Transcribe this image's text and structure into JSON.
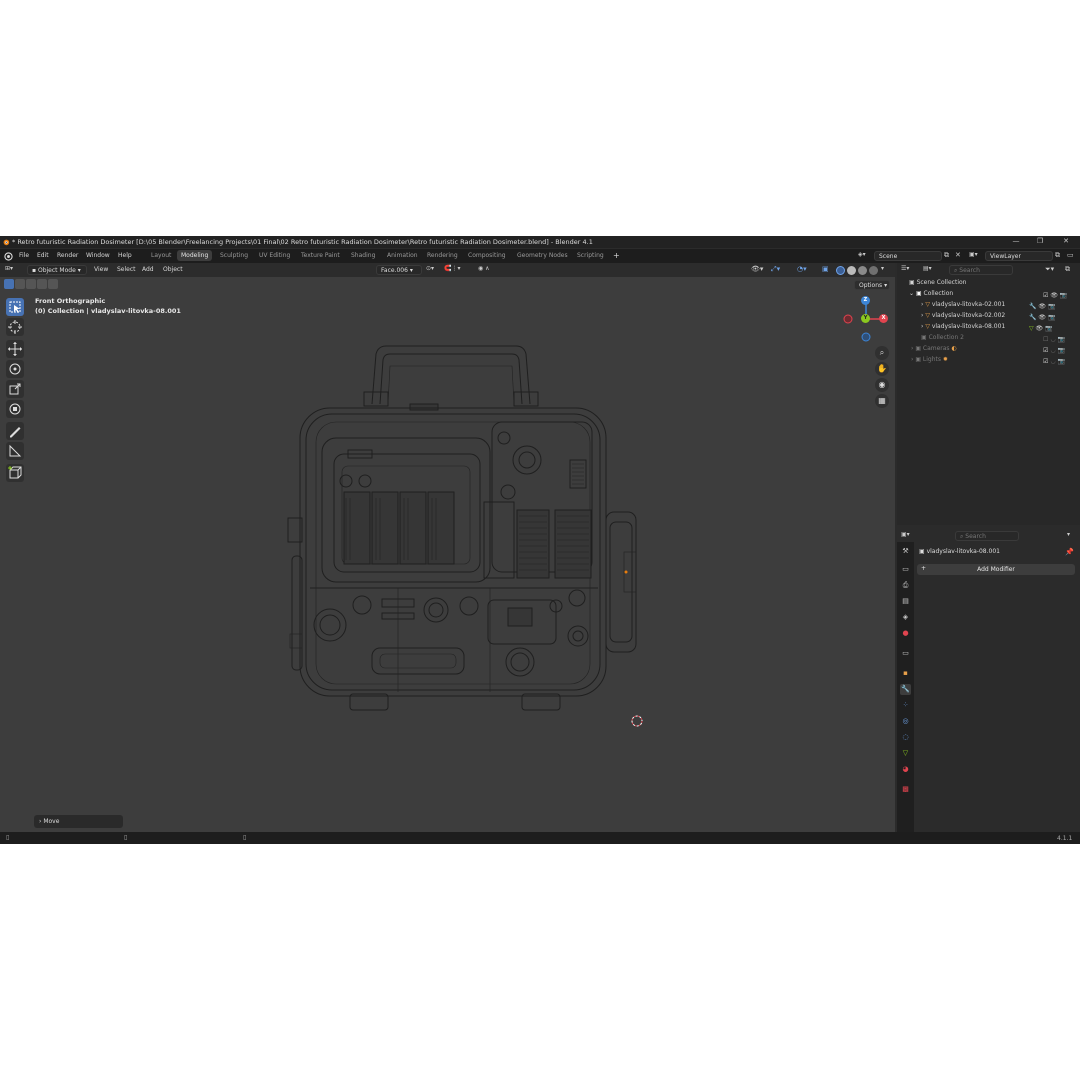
{
  "window": {
    "title": "* Retro futuristic Radiation Dosimeter [D:\\05 Blender\\Freelancing Projects\\01 Final\\02 Retro futuristic Radiation Dosimeter\\Retro futuristic Radiation Dosimeter.blend] - Blender 4.1",
    "controls": [
      "—",
      "❐",
      "✕"
    ]
  },
  "menu": [
    "File",
    "Edit",
    "Render",
    "Window",
    "Help"
  ],
  "workspaces": [
    "Layout",
    "Modeling",
    "Sculpting",
    "UV Editing",
    "Texture Paint",
    "Shading",
    "Animation",
    "Rendering",
    "Compositing",
    "Geometry Nodes",
    "Scripting"
  ],
  "add_workspace": "+",
  "scene": {
    "name": "Scene",
    "view_layer": "ViewLayer"
  },
  "header3d": {
    "mode": "Object Mode",
    "menus": [
      "View",
      "Select",
      "Add",
      "Object"
    ],
    "active_face": "Face.006",
    "options": "Options"
  },
  "viewport": {
    "view_name": "Front Orthographic",
    "collection_info": "(0) Collection | vladyslav-litovka-08.001",
    "gizmo": {
      "z": "Z",
      "y": "Y",
      "x": "X"
    },
    "last_operator": "Move"
  },
  "outliner": {
    "search_placeholder": "Search",
    "scene_collection": "Scene Collection",
    "collection": "Collection",
    "objects": [
      "vladyslav-litovka-02.001",
      "vladyslav-litovka-02.002",
      "vladyslav-litovka-08.001"
    ],
    "collection2": "Collection 2",
    "cameras": "Cameras",
    "lights": "Lights"
  },
  "properties": {
    "search_placeholder": "Search",
    "object_name": "vladyslav-litovka-08.001",
    "add_modifier": "Add Modifier"
  },
  "status": {
    "version": "4.1.1"
  },
  "colors": {
    "accent": "#4772b3",
    "axis_x": "#e0444f",
    "axis_y": "#8bc81f",
    "axis_z": "#3d85d6",
    "viewport_bg": "#3d3d3d"
  }
}
